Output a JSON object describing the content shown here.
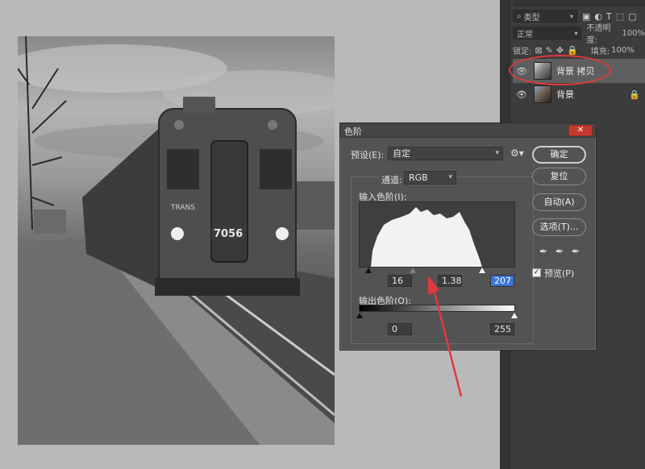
{
  "colors": {
    "annotation_red": "#e2383c",
    "dialog_bg": "#535353",
    "panel_bg": "#3c3c3c",
    "highlight_blue": "#3875d7"
  },
  "photo": {
    "train_number": "7056",
    "brand_text": "TRANS"
  },
  "layers_panel": {
    "filter_label": "类型",
    "blend_mode": "正常",
    "opacity_label": "不透明度:",
    "opacity_value": "100%",
    "lock_label": "锁定:",
    "fill_label": "填充:",
    "fill_value": "100%",
    "layers": [
      {
        "name": "背景 拷贝",
        "selected": true
      },
      {
        "name": "背景",
        "selected": false,
        "locked": true
      }
    ]
  },
  "levels_dialog": {
    "title": "色阶",
    "close_label": "✕",
    "preset_label": "预设(E):",
    "preset_value": "自定",
    "channel_label": "通道:",
    "channel_value": "RGB",
    "input_levels_label": "输入色阶(I):",
    "output_levels_label": "输出色阶(O):",
    "input_black": "16",
    "input_gamma": "1.38",
    "input_white": "207",
    "output_black": "0",
    "output_white": "255",
    "buttons": {
      "ok": "确定",
      "reset": "复位",
      "auto": "自动(A)",
      "options": "选项(T)..."
    },
    "preview_label": "预览(P)",
    "preview_checked": true
  }
}
